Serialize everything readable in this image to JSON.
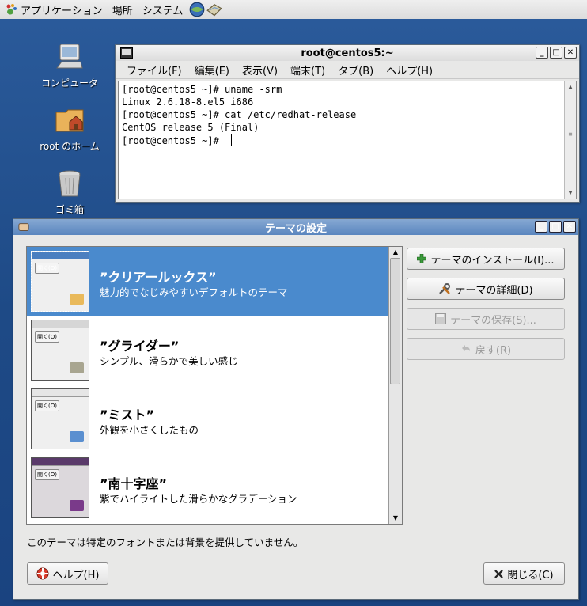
{
  "top_panel": {
    "menus": [
      {
        "label": "アプリケーション",
        "icon": "gnome-foot-icon"
      },
      {
        "label": "場所"
      },
      {
        "label": "システム"
      }
    ],
    "launchers": [
      "web-browser-icon",
      "mail-icon"
    ]
  },
  "desktop": {
    "icons": [
      {
        "label": "コンピュータ",
        "icon": "computer-icon"
      },
      {
        "label": "root のホーム",
        "icon": "home-folder-icon"
      },
      {
        "label": "ゴミ箱",
        "icon": "trash-icon"
      }
    ]
  },
  "terminal": {
    "title": "root@centos5:~",
    "menu": [
      "ファイル(F)",
      "編集(E)",
      "表示(V)",
      "端末(T)",
      "タブ(B)",
      "ヘルプ(H)"
    ],
    "lines": [
      "[root@centos5 ~]# uname -srm",
      "Linux 2.6.18-8.el5 i686",
      "[root@centos5 ~]# cat /etc/redhat-release",
      "CentOS release 5 (Final)",
      "[root@centos5 ~]# "
    ]
  },
  "theme_dialog": {
    "title": "テーマの設定",
    "themes": [
      {
        "name": "”クリアールックス”",
        "description": "魅力的でなじみやすいデフォルトのテーマ",
        "thumb_button": "開く(O)",
        "selected": true,
        "folder_color": "#e9b95a",
        "bar_color": "#4a7fc0"
      },
      {
        "name": "”グライダー”",
        "description": "シンプル、滑らかで美しい感じ",
        "thumb_button": "開く(O)",
        "selected": false,
        "folder_color": "#a8a590",
        "bar_color": "#d6d6d6"
      },
      {
        "name": "”ミスト”",
        "description": "外観を小さくしたもの",
        "thumb_button": "開く(O)",
        "selected": false,
        "folder_color": "#5a8fd0",
        "bar_color": "#e6e6e6"
      },
      {
        "name": "”南十字座”",
        "description": "紫でハイライトした滑らかなグラデーション",
        "thumb_button": "開く(O)",
        "selected": false,
        "folder_color": "#7a3a8a",
        "bar_color": "#5a3a6a"
      }
    ],
    "buttons": {
      "install": "テーマのインストール(I)...",
      "details": "テーマの詳細(D)",
      "save": "テーマの保存(S)...",
      "revert": "戻す(R)"
    },
    "status": "このテーマは特定のフォントまたは背景を提供していません。",
    "help": "ヘルプ(H)",
    "close": "閉じる(C)"
  }
}
